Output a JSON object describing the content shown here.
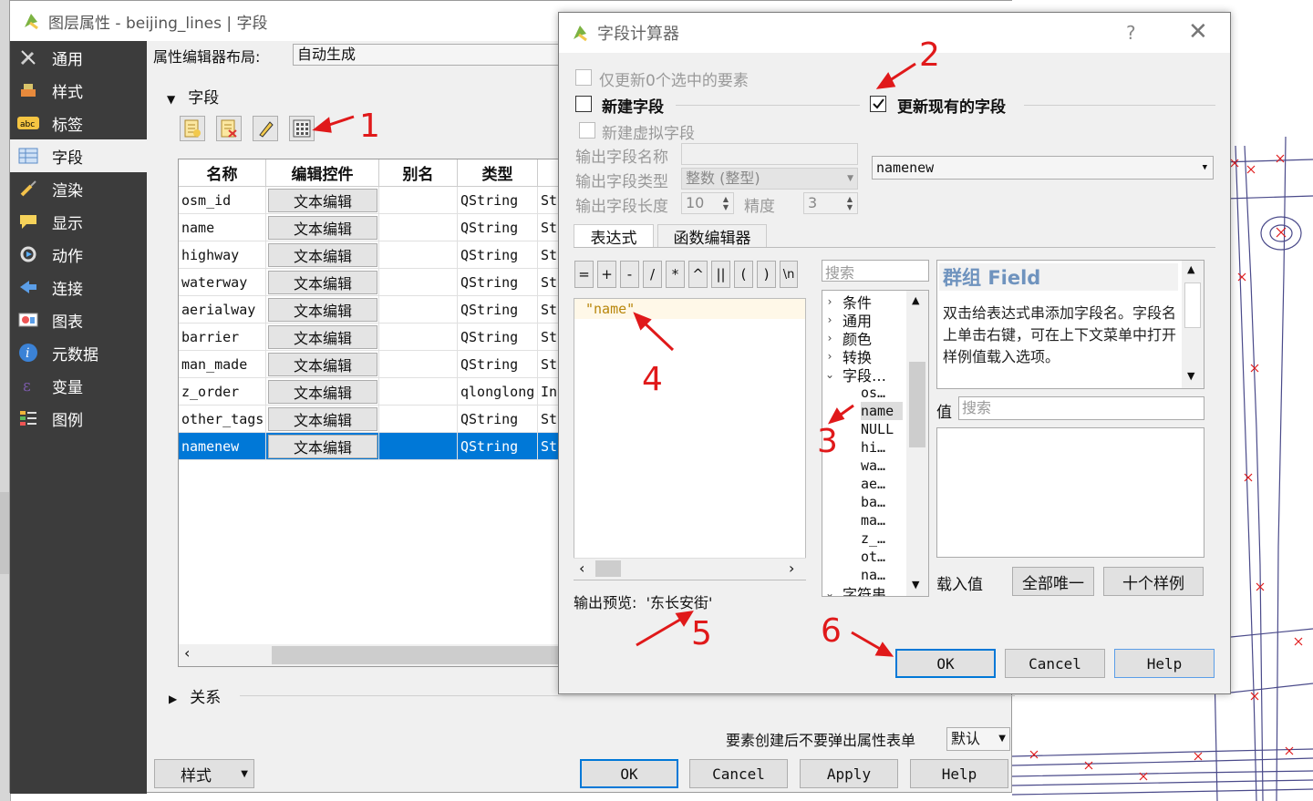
{
  "main_window": {
    "title": "图层属性 - beijing_lines | 字段",
    "sidebar": [
      {
        "label": "通用",
        "icon": "wrench-icon"
      },
      {
        "label": "样式",
        "icon": "brush-icon"
      },
      {
        "label": "标签",
        "icon": "abc-label-icon"
      },
      {
        "label": "字段",
        "icon": "table-icon",
        "active": true
      },
      {
        "label": "渲染",
        "icon": "paintbrush-icon"
      },
      {
        "label": "显示",
        "icon": "speech-bubble-icon"
      },
      {
        "label": "动作",
        "icon": "gear-action-icon"
      },
      {
        "label": "连接",
        "icon": "join-arrow-icon"
      },
      {
        "label": "图表",
        "icon": "chart-icon"
      },
      {
        "label": "元数据",
        "icon": "info-icon"
      },
      {
        "label": "变量",
        "icon": "epsilon-icon"
      },
      {
        "label": "图例",
        "icon": "legend-icon"
      }
    ],
    "layout_label": "属性编辑器布局:",
    "layout_value": "自动生成",
    "fields_section": "字段",
    "table": {
      "headers": [
        "名称",
        "编辑控件",
        "别名",
        "类型",
        ""
      ],
      "rows": [
        {
          "name": "osm_id",
          "widget": "文本编辑",
          "alias": "",
          "type": "QString",
          "type_name": "St"
        },
        {
          "name": "name",
          "widget": "文本编辑",
          "alias": "",
          "type": "QString",
          "type_name": "St"
        },
        {
          "name": "highway",
          "widget": "文本编辑",
          "alias": "",
          "type": "QString",
          "type_name": "St"
        },
        {
          "name": "waterway",
          "widget": "文本编辑",
          "alias": "",
          "type": "QString",
          "type_name": "St"
        },
        {
          "name": "aerialway",
          "widget": "文本编辑",
          "alias": "",
          "type": "QString",
          "type_name": "St"
        },
        {
          "name": "barrier",
          "widget": "文本编辑",
          "alias": "",
          "type": "QString",
          "type_name": "St"
        },
        {
          "name": "man_made",
          "widget": "文本编辑",
          "alias": "",
          "type": "QString",
          "type_name": "St"
        },
        {
          "name": "z_order",
          "widget": "文本编辑",
          "alias": "",
          "type": "qlonglong",
          "type_name": "In"
        },
        {
          "name": "other_tags",
          "widget": "文本编辑",
          "alias": "",
          "type": "QString",
          "type_name": "St"
        },
        {
          "name": "namenew",
          "widget": "文本编辑",
          "alias": "",
          "type": "QString",
          "type_name": "St",
          "selected": true
        }
      ]
    },
    "relations_section": "关系",
    "popup_label": "要素创建后不要弹出属性表单",
    "popup_value": "默认",
    "style_button": "样式",
    "buttons": {
      "ok": "OK",
      "cancel": "Cancel",
      "apply": "Apply",
      "help": "Help"
    }
  },
  "dialog": {
    "title": "字段计算器",
    "help_glyph": "?",
    "close_glyph": "✕",
    "only_selected": "仅更新0个选中的要素",
    "new_field": "新建字段",
    "update_field": "更新现有的字段",
    "virtual_field": "新建虚拟字段",
    "out_name_label": "输出字段名称",
    "out_type_label": "输出字段类型",
    "out_type_value": "整数 (整型)",
    "out_len_label": "输出字段长度",
    "out_len_value": "10",
    "precision_label": "精度",
    "precision_value": "3",
    "existing_field": "namenew",
    "tabs": [
      "表达式",
      "函数编辑器"
    ],
    "operators": [
      "=",
      "+",
      "-",
      "/",
      "*",
      "^",
      "||",
      "(",
      ")",
      "\\n"
    ],
    "expression": "\"name\"",
    "preview_label": "输出预览:",
    "preview_value": "'东长安街'",
    "search_placeholder": "搜索",
    "tree_groups": [
      "条件",
      "通用",
      "颜色",
      "转换",
      "字段…"
    ],
    "tree_fields": [
      "os…",
      "name",
      "NULL",
      "hi…",
      "wa…",
      "ae…",
      "ba…",
      "ma…",
      "z_…",
      "ot…",
      "na…"
    ],
    "tree_after": "字符串",
    "help_title_prefix": "群组 ",
    "help_title_field": "Field",
    "help_text": "双击给表达式串添加字段名。字段名上单击右键，可在上下文菜单中打开样例值载入选项。",
    "value_label": "值",
    "value_search": "搜索",
    "load_label": "载入值",
    "all_unique": "全部唯一",
    "ten_samples": "十个样例",
    "buttons": {
      "ok": "OK",
      "cancel": "Cancel",
      "help": "Help"
    }
  },
  "annotations": [
    "1",
    "2",
    "3",
    "4",
    "5",
    "6"
  ],
  "colors": {
    "selection": "#0078d7",
    "annotation": "#e0191a",
    "sidebar": "#3c3c3c"
  }
}
